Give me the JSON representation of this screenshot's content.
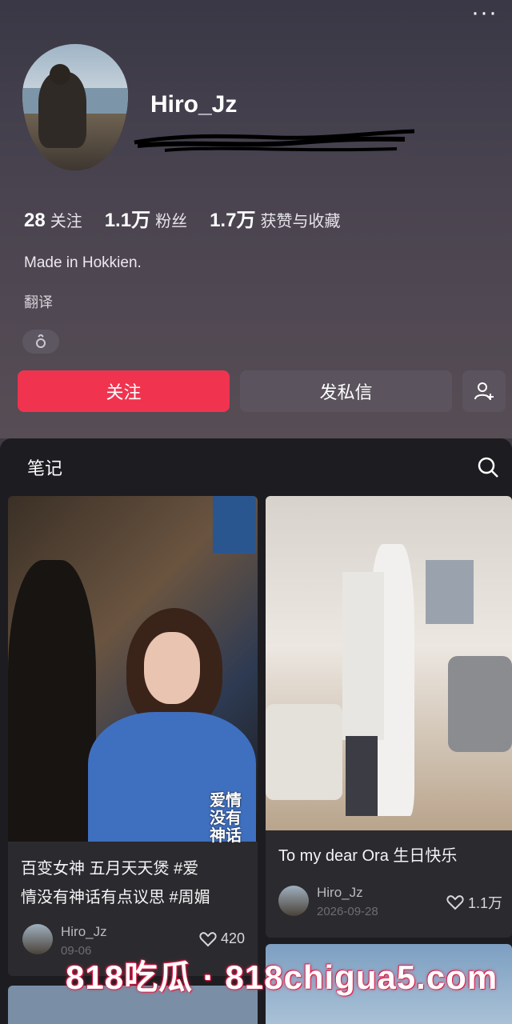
{
  "header": {
    "more_icon": "more-horizontal-icon",
    "username": "Hiro_Jz",
    "stats": [
      {
        "value": "28",
        "label": "关注"
      },
      {
        "value": "1.1万",
        "label": "粉丝"
      },
      {
        "value": "1.7万",
        "label": "获赞与收藏"
      }
    ],
    "bio": "Made in Hokkien.",
    "translate": "翻译",
    "gender_icon": "male-icon"
  },
  "actions": {
    "follow": "关注",
    "message": "发私信",
    "add_friend_icon": "add-user-icon"
  },
  "tabs": {
    "notes": "笔记",
    "search_icon": "search-icon"
  },
  "posts": [
    {
      "overlay_text": "爱情没有神话",
      "title_line1": "百变女神 五月天天煲 #爱",
      "title_line2": "情没有神话有点议思 #周媚",
      "author": "Hiro_Jz",
      "date": "09-06",
      "likes": "420"
    },
    {
      "title_line1": "To my dear Ora 生日快乐",
      "author": "Hiro_Jz",
      "date": "2026-09-28",
      "likes": "1.1万"
    }
  ],
  "watermark": "818吃瓜 · 818chigua5.com",
  "colors": {
    "accent": "#f0344f",
    "panel_bg": "#1d1d21",
    "card_bg": "#2b2b2f"
  }
}
